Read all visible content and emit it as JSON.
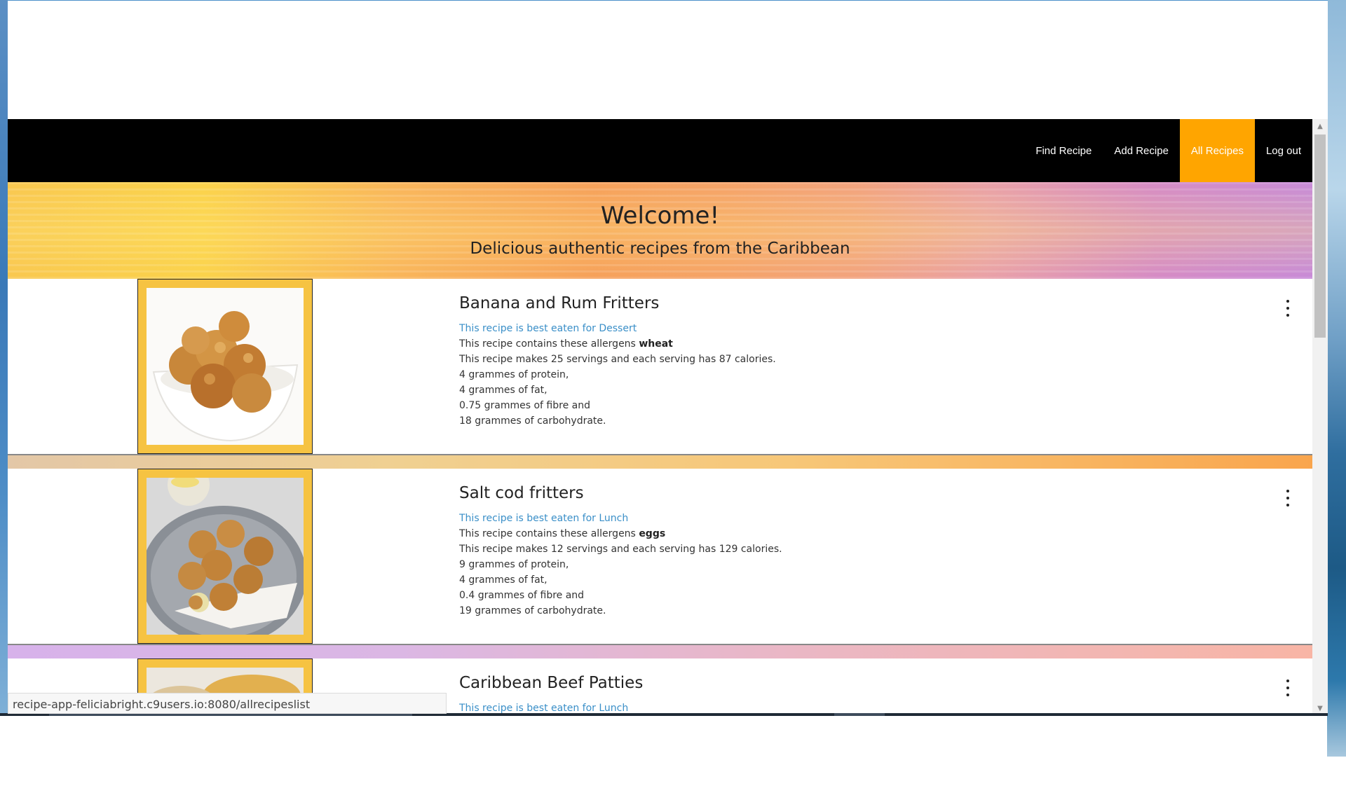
{
  "status_url": "recipe-app-feliciabright.c9users.io:8080/allrecipeslist",
  "nav": {
    "items": [
      {
        "label": "Find Recipe",
        "active": false
      },
      {
        "label": "Add Recipe",
        "active": false
      },
      {
        "label": "All Recipes",
        "active": true
      },
      {
        "label": "Log out",
        "active": false
      }
    ],
    "accent_color": "#ffa500"
  },
  "banner": {
    "title": "Welcome!",
    "subtitle": "Delicious authentic recipes from the Caribbean"
  },
  "recipes": [
    {
      "title": "Banana and Rum Fritters",
      "meal_text": "This recipe is best eaten for Dessert",
      "allergens_prefix": "This recipe contains these allergens",
      "allergens": "wheat",
      "servings_line": "This recipe makes 25 servings and each serving has 87 calories.",
      "protein": "4 grammes of protein,",
      "fat": "4 grammes of fat,",
      "fibre": "0.75 grammes of fibre and",
      "carbs": "18 grammes of carbohydrate."
    },
    {
      "title": "Salt cod fritters",
      "meal_text": "This recipe is best eaten for Lunch",
      "allergens_prefix": "This recipe contains these allergens",
      "allergens": "eggs",
      "servings_line": "This recipe makes 12 servings and each serving has 129 calories.",
      "protein": "9 grammes of protein,",
      "fat": "4 grammes of fat,",
      "fibre": "0.4 grammes of fibre and",
      "carbs": "19 grammes of carbohydrate."
    },
    {
      "title": "Caribbean Beef Patties",
      "meal_text": "This recipe is best eaten for Lunch"
    }
  ]
}
